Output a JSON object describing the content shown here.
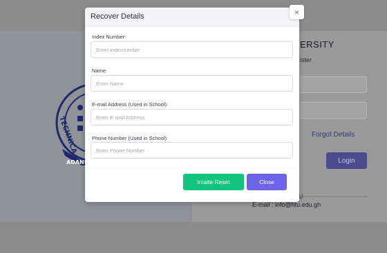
{
  "background": {
    "title_fragment": "ERSITY",
    "subtitle_fragment": "ister",
    "forgot_label": "Forgot Details",
    "login_label": "Login",
    "line_fragment": "U",
    "email": "E-mail : info@htu.edu.gh",
    "logo": {
      "ring_text_left": "TECHNICA",
      "ring_text_bottom": "ADANU"
    }
  },
  "modal": {
    "title": "Recover Details",
    "close_icon": "×",
    "fields": [
      {
        "label": "Index Number:",
        "placeholder": "Enter indexnumber",
        "value": ""
      },
      {
        "label": "Name:",
        "placeholder": "Enter Name",
        "value": ""
      },
      {
        "label": "E-mail Address (Used in School):",
        "placeholder": "Enter E-mail Address",
        "value": ""
      },
      {
        "label": "Phone Number (Used in School):",
        "placeholder": "Enter Phone Number",
        "value": ""
      }
    ],
    "reset_label": "Iniaite Reset",
    "close_label": "Close"
  },
  "colors": {
    "reset_button": "#12c47c",
    "close_button": "#6c63e8",
    "login_button": "#4b4a8c"
  }
}
